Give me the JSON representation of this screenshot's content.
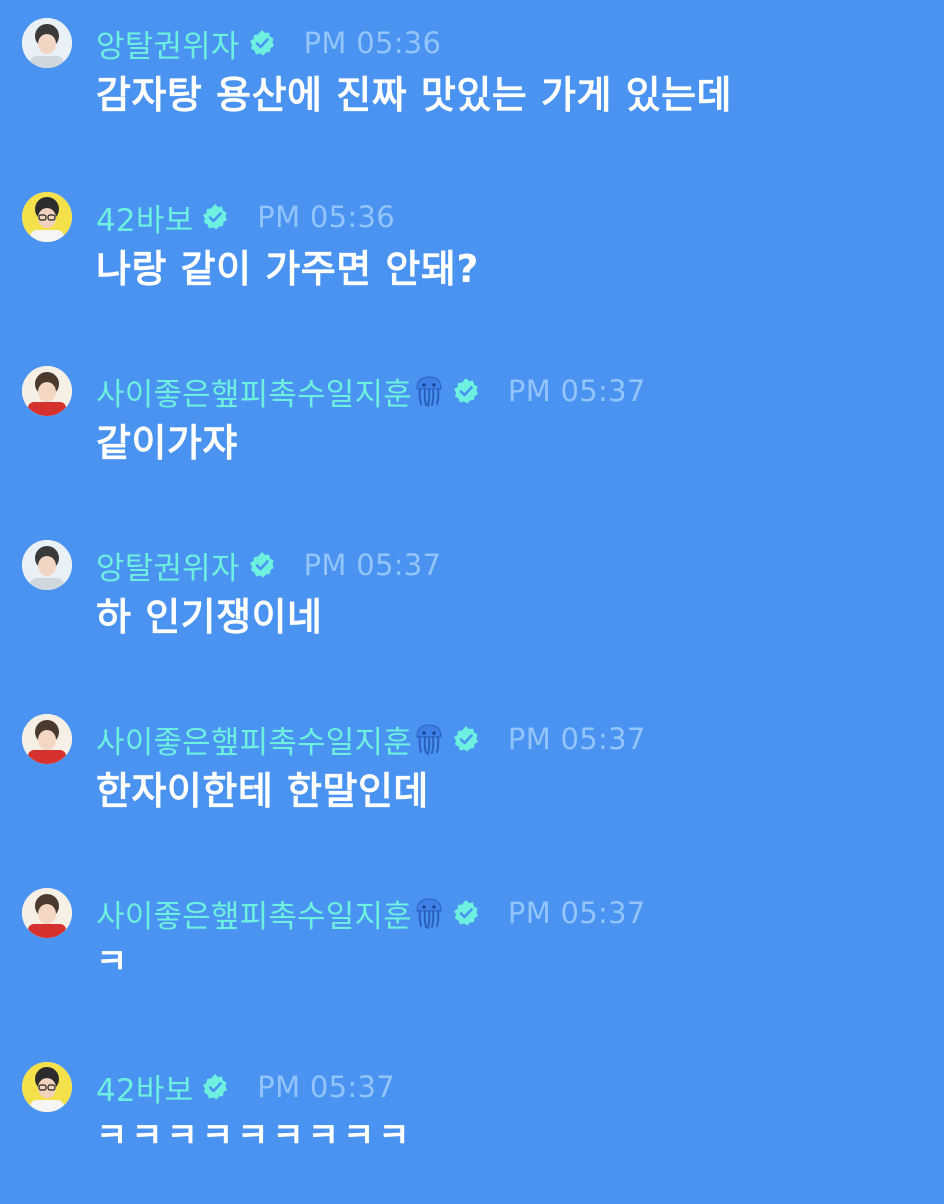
{
  "colors": {
    "background": "#4a93f0",
    "username": "#6df0df",
    "timestamp": "#93c4fb",
    "message_text": "#ffffff",
    "verified_badge": "#6df0df"
  },
  "messages": [
    {
      "user": "앙탈권위자",
      "time": "PM 05:36",
      "text": "감자탕 용산에 진짜 맛있는 가게 있는데",
      "avatar_icon": "avatar-a",
      "has_extra_icon": false
    },
    {
      "user": "42바보",
      "time": "PM 05:36",
      "text": "나랑 같이 가주면 안돼?",
      "avatar_icon": "avatar-b",
      "has_extra_icon": false
    },
    {
      "user": "사이좋은햎피촉수일지훈",
      "time": "PM 05:37",
      "text": "같이가쟈",
      "avatar_icon": "avatar-c",
      "has_extra_icon": true
    },
    {
      "user": "앙탈권위자",
      "time": "PM 05:37",
      "text": "하 인기쟁이네",
      "avatar_icon": "avatar-a",
      "has_extra_icon": false
    },
    {
      "user": "사이좋은햎피촉수일지훈",
      "time": "PM 05:37",
      "text": "한자이한테 한말인데",
      "avatar_icon": "avatar-c",
      "has_extra_icon": true
    },
    {
      "user": "사이좋은햎피촉수일지훈",
      "time": "PM 05:37",
      "text": "ㅋ",
      "avatar_icon": "avatar-c",
      "has_extra_icon": true
    },
    {
      "user": "42바보",
      "time": "PM 05:37",
      "text": "ㅋㅋㅋㅋㅋㅋㅋㅋㅋ",
      "avatar_icon": "avatar-b",
      "has_extra_icon": false
    }
  ]
}
